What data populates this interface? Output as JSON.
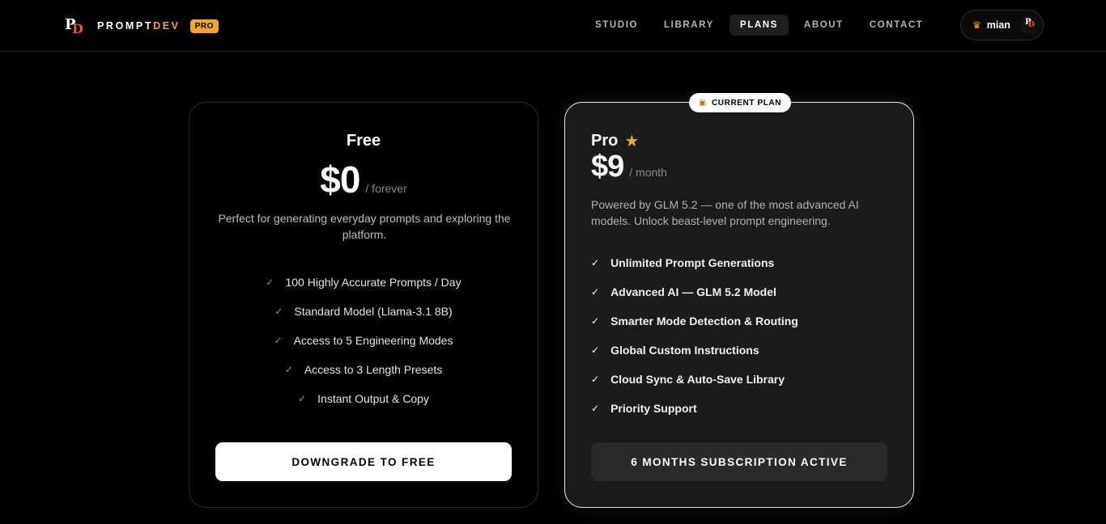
{
  "nav": {
    "brand_logo_p": "P",
    "brand_logo_d": "D",
    "brand_name_main": "PROMPT",
    "brand_name_accent": "DEV",
    "badge": "PRO",
    "links": [
      {
        "label": "STUDIO"
      },
      {
        "label": "LIBRARY"
      },
      {
        "label": "PLANS",
        "active": true
      },
      {
        "label": "ABOUT"
      },
      {
        "label": "CONTACT"
      }
    ],
    "user": {
      "crown_icon": "crown-icon",
      "name": "mian",
      "avatar_p": "P",
      "avatar_d": "D"
    }
  },
  "plans": {
    "free": {
      "name": "Free",
      "price": "$0",
      "period": "/ forever",
      "description": "Perfect for generating everyday prompts and exploring the platform.",
      "features": [
        "100 Highly Accurate Prompts / Day",
        "Standard Model (Llama-3.1 8B)",
        "Access to 5 Engineering Modes",
        "Access to 3 Length Presets",
        "Instant Output & Copy"
      ],
      "button": "DOWNGRADE TO FREE"
    },
    "pro": {
      "badge": "CURRENT PLAN",
      "name": "Pro",
      "price": "$9",
      "period": "/ month",
      "description": "Powered by GLM 5.2 — one of the most advanced AI models. Unlock beast-level prompt engineering.",
      "features": [
        "Unlimited Prompt Generations",
        "Advanced AI — GLM 5.2 Model",
        "Smarter Mode Detection & Routing",
        "Global Custom Instructions",
        "Cloud Sync & Auto-Save Library",
        "Priority Support"
      ],
      "button": "6 MONTHS SUBSCRIPTION ACTIVE"
    }
  },
  "colors": {
    "accent": "#f5a623",
    "logo_d": "#e05a2a",
    "background": "#000000",
    "pro_card": "#1b1b1b"
  },
  "icons": {
    "check": "✓",
    "star": "★",
    "crown": "♛",
    "badge": "▣"
  }
}
